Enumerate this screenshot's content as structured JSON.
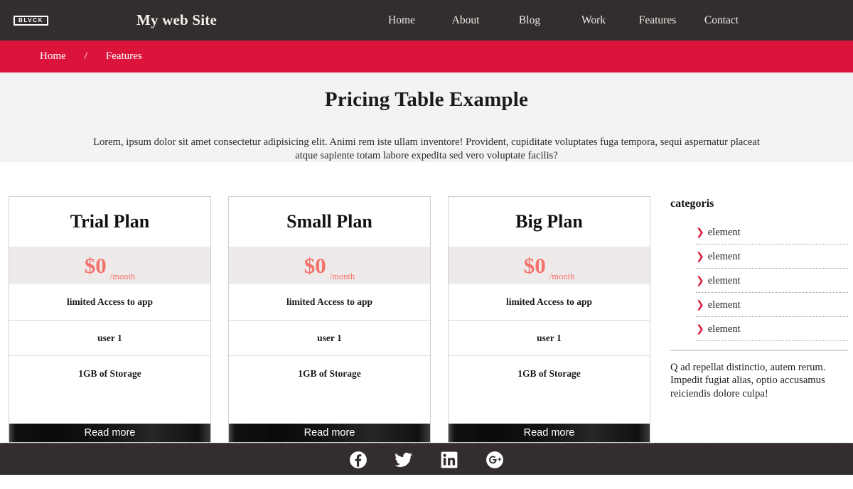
{
  "navbar": {
    "logo_text": "BLVCK",
    "site_title": "My web Site",
    "links": [
      {
        "label": "Home"
      },
      {
        "label": "About"
      },
      {
        "label": "Blog"
      },
      {
        "label": "Work"
      },
      {
        "label": "Features"
      },
      {
        "label": "Contact"
      }
    ]
  },
  "breadcrumb": {
    "home": "Home",
    "separator": "/",
    "current": "Features"
  },
  "hero": {
    "title": "Pricing Table Example",
    "subtitle": "Lorem, ipsum dolor sit amet consectetur adipisicing elit. Animi rem iste ullam inventore! Provident, cupiditate voluptates fuga tempora, sequi aspernatur placeat atque sapiente totam labore expedita sed vero voluptate facilis?"
  },
  "pricing": {
    "cards": [
      {
        "title": "Trial Plan",
        "amount": "$0",
        "period": "/month",
        "features": [
          "limited Access to app",
          "user 1",
          "1GB of Storage"
        ],
        "button_label": "Read more"
      },
      {
        "title": "Small Plan",
        "amount": "$0",
        "period": "/month",
        "features": [
          "limited Access to app",
          "user 1",
          "1GB of Storage"
        ],
        "button_label": "Read more"
      },
      {
        "title": "Big Plan",
        "amount": "$0",
        "period": "/month",
        "features": [
          "limited Access to app",
          "user 1",
          "1GB of Storage"
        ],
        "button_label": "Read more"
      }
    ]
  },
  "sidebar": {
    "heading": "categoris",
    "items": [
      {
        "label": "element"
      },
      {
        "label": "element"
      },
      {
        "label": "element"
      },
      {
        "label": "element"
      },
      {
        "label": "element"
      }
    ],
    "chevron": "❯",
    "text": "Q ad repellat distinctio, autem rerum. Impedit fugiat alias, optio accusamus reiciendis dolore culpa!"
  },
  "footer": {
    "socials": [
      {
        "name": "facebook-icon"
      },
      {
        "name": "twitter-icon"
      },
      {
        "name": "linkedin-icon"
      },
      {
        "name": "google-plus-icon"
      }
    ]
  },
  "colors": {
    "nav_bg": "#332E2D",
    "breadcrumb_bg": "#DC143C",
    "hero_bg": "#f3f3f3",
    "price_text": "#F4726C",
    "price_band_bg": "#eeeae9",
    "chevron_red": "#D81E3F"
  }
}
